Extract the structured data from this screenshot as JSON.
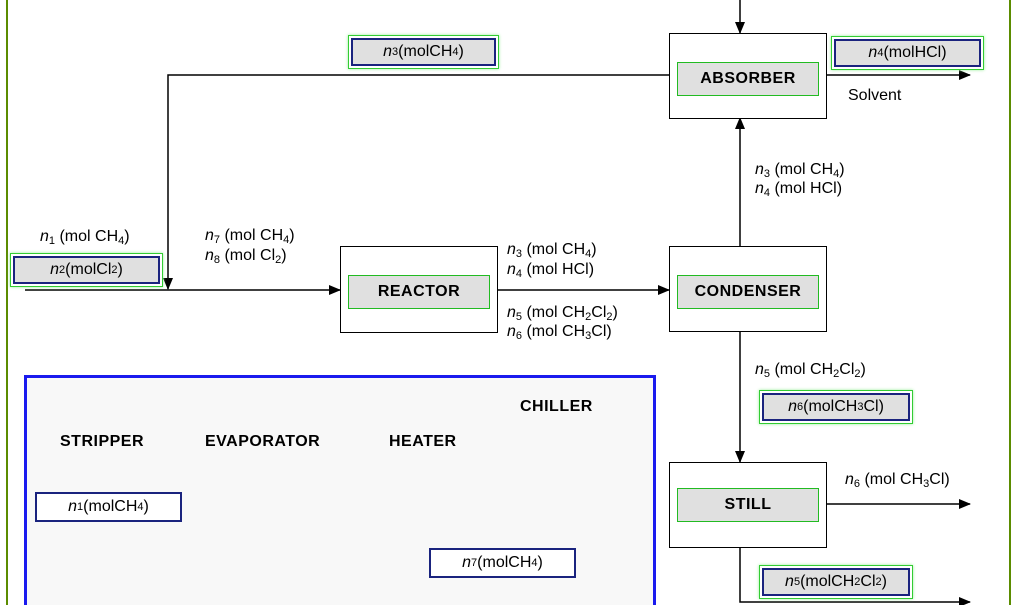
{
  "units": {
    "absorber": "ABSORBER",
    "reactor": "REACTOR",
    "condenser": "CONDENSER",
    "still": "STILL"
  },
  "stream_text": {
    "solvent": "Solvent"
  },
  "labels": {
    "n1_ch4": {
      "var": "n",
      "idx": "1",
      "formula": [
        [
          "CH",
          "4"
        ]
      ]
    },
    "n2_cl2": {
      "var": "n",
      "idx": "2",
      "formula": [
        [
          "Cl",
          "2"
        ]
      ]
    },
    "n3_ch4": {
      "var": "n",
      "idx": "3",
      "formula": [
        [
          "CH",
          "4"
        ]
      ]
    },
    "n4_hcl": {
      "var": "n",
      "idx": "4",
      "formula": [
        [
          "HCl",
          ""
        ]
      ]
    },
    "n5_ch2cl2": {
      "var": "n",
      "idx": "5",
      "formula": [
        [
          "CH",
          "2"
        ],
        [
          "Cl",
          "2"
        ]
      ]
    },
    "n6_ch3cl": {
      "var": "n",
      "idx": "6",
      "formula": [
        [
          "CH",
          "3"
        ],
        [
          "Cl",
          ""
        ]
      ]
    },
    "n7_ch4": {
      "var": "n",
      "idx": "7",
      "formula": [
        [
          "CH",
          "4"
        ]
      ]
    },
    "n8_cl2": {
      "var": "n",
      "idx": "8",
      "formula": [
        [
          "Cl",
          "2"
        ]
      ]
    }
  },
  "placed_labels": [
    "n3_ch4",
    "n4_hcl",
    "n2_cl2",
    "n6_ch3cl",
    "n5_ch2cl2"
  ],
  "static_labels": [
    "n1_ch4",
    "n7_ch4",
    "n8_cl2",
    "n3_ch4",
    "n4_hcl",
    "n5_ch2cl2",
    "n6_ch3cl",
    "n3_ch4",
    "n4_hcl",
    "n5_ch2cl2",
    "n6_ch3cl"
  ],
  "palette": {
    "units": [
      "CHILLER",
      "STRIPPER",
      "EVAPORATOR",
      "HEATER"
    ],
    "labels": [
      "n1_ch4",
      "n7_ch4"
    ]
  },
  "colors": {
    "accent_green": "#22bb22",
    "label_border": "#1a237e",
    "palette_border": "#1a1aee",
    "frame": "#5b8c00"
  }
}
